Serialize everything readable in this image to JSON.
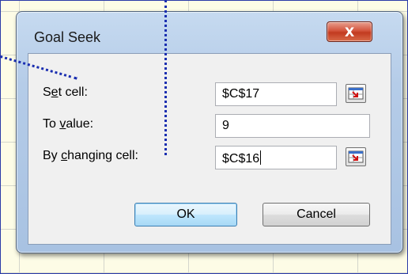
{
  "dialog": {
    "title": "Goal Seek",
    "close_label": "X"
  },
  "fields": {
    "set_cell": {
      "label_pre": "S",
      "label_accel": "e",
      "label_post": "t cell:",
      "value": "$C$17"
    },
    "to_value": {
      "label_pre": "To ",
      "label_accel": "v",
      "label_post": "alue:",
      "value": "9"
    },
    "changing_cell": {
      "label_pre": "By ",
      "label_accel": "c",
      "label_post": "hanging cell:",
      "value": "$C$16"
    }
  },
  "buttons": {
    "ok": "OK",
    "cancel": "Cancel"
  },
  "colors": {
    "accent_dots": "#1a2eb0",
    "sheet_bg": "#fdfce6",
    "close_button": "#c23a20"
  },
  "icons": {
    "range_picker": "collapse-dialog-icon"
  }
}
